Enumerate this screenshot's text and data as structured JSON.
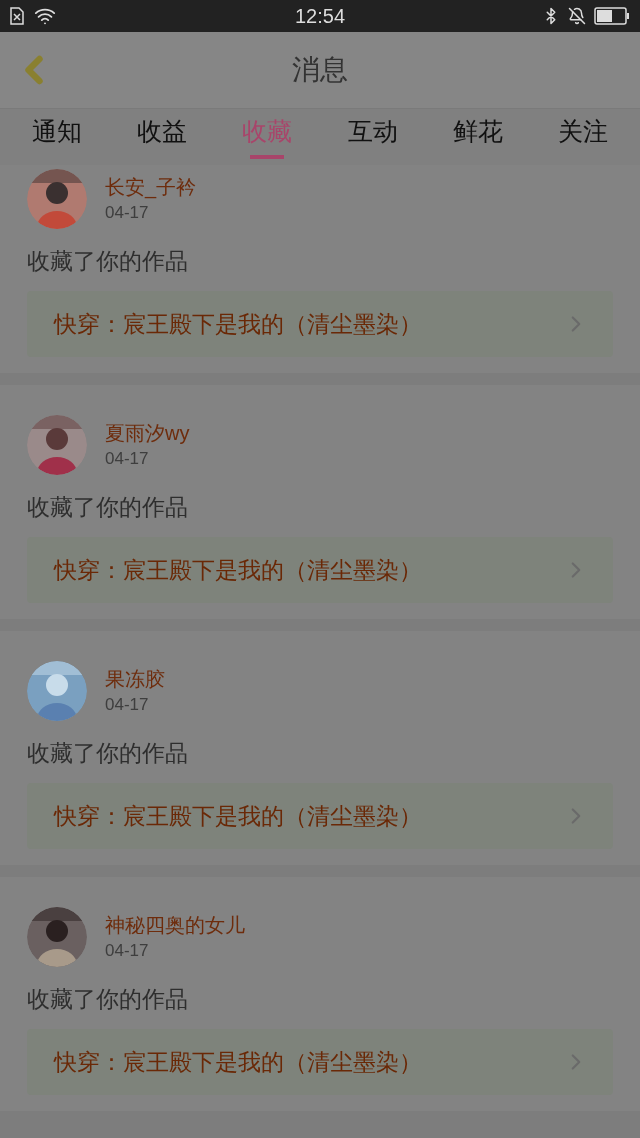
{
  "status_bar": {
    "time": "12:54"
  },
  "header": {
    "title": "消息"
  },
  "tabs": [
    {
      "label": "通知",
      "selected": false
    },
    {
      "label": "收益",
      "selected": false
    },
    {
      "label": "收藏",
      "selected": true
    },
    {
      "label": "互动",
      "selected": false
    },
    {
      "label": "鲜花",
      "selected": false
    },
    {
      "label": "关注",
      "selected": false
    }
  ],
  "messages": [
    {
      "user": "长安_子衿",
      "date": "04-17",
      "text": "收藏了你的作品",
      "book": "快穿：宸王殿下是我的（清尘墨染）"
    },
    {
      "user": "夏雨汐wy",
      "date": "04-17",
      "text": "收藏了你的作品",
      "book": "快穿：宸王殿下是我的（清尘墨染）"
    },
    {
      "user": "果冻胶",
      "date": "04-17",
      "text": "收藏了你的作品",
      "book": "快穿：宸王殿下是我的（清尘墨染）"
    },
    {
      "user": "神秘四奥的女儿",
      "date": "04-17",
      "text": "收藏了你的作品",
      "book": "快穿：宸王殿下是我的（清尘墨染）"
    }
  ]
}
